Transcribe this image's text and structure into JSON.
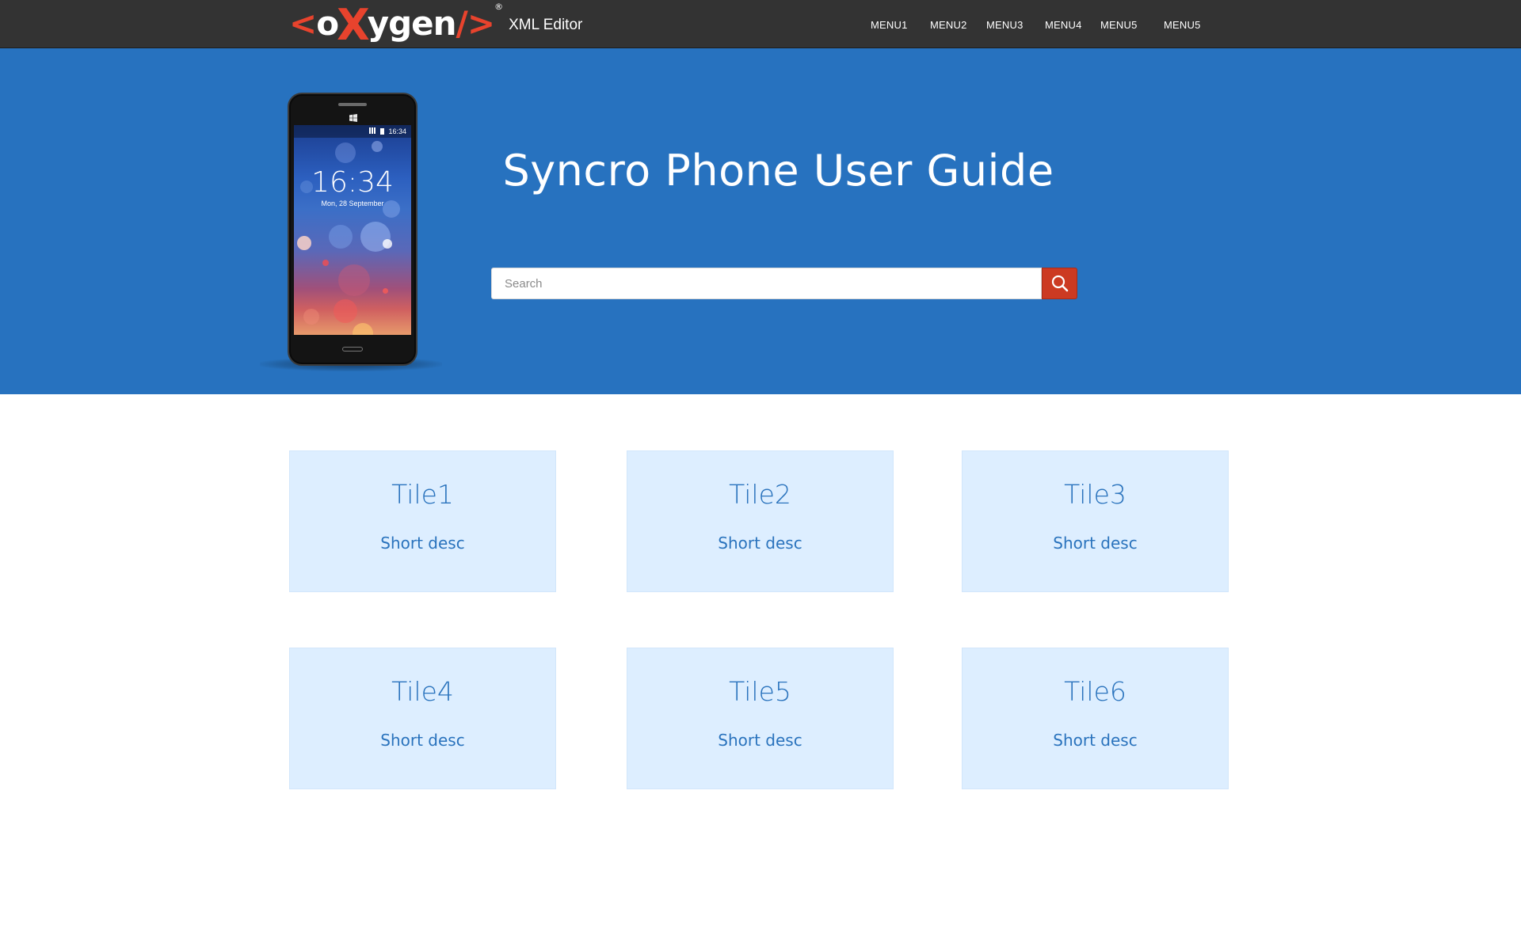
{
  "header": {
    "logo": {
      "open_bracket": "<",
      "o": "o",
      "x": "X",
      "rest": "ygen",
      "close_bracket": "/>",
      "registered": "®"
    },
    "tagline": "XML Editor",
    "menu": [
      {
        "label": "MENU1"
      },
      {
        "label": "MENU2"
      },
      {
        "label": "MENU3"
      },
      {
        "label": "MENU4"
      },
      {
        "label": "MENU5"
      },
      {
        "label": "MENU5"
      }
    ]
  },
  "hero": {
    "title": "Syncro Phone User Guide",
    "phone": {
      "status_time": "16:34",
      "lock_time": "16:34",
      "lock_date": "Mon, 28 September"
    },
    "search": {
      "placeholder": "Search",
      "value": ""
    }
  },
  "tiles": [
    {
      "title": "Tile1",
      "desc": "Short desc"
    },
    {
      "title": "Tile2",
      "desc": "Short desc"
    },
    {
      "title": "Tile3",
      "desc": "Short desc"
    },
    {
      "title": "Tile4",
      "desc": "Short desc"
    },
    {
      "title": "Tile5",
      "desc": "Short desc"
    },
    {
      "title": "Tile6",
      "desc": "Short desc"
    }
  ],
  "colors": {
    "header_bg": "#333333",
    "hero_bg": "#2772bf",
    "accent": "#e8432d",
    "search_button": "#cc3a22",
    "tile_bg": "#ddeeff",
    "tile_text": "#2a73bd"
  },
  "icons": {
    "search": "search-icon",
    "windows": "windows-logo-icon"
  }
}
